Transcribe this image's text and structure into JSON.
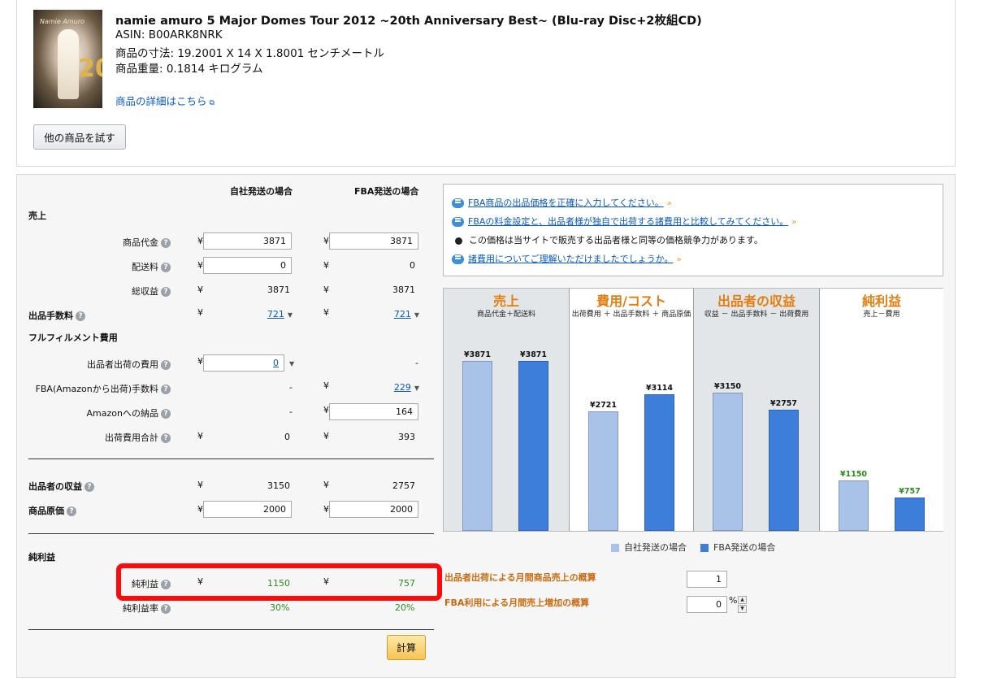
{
  "product": {
    "title": "namie amuro 5 Major Domes Tour 2012 ~20th Anniversary Best~ (Blu-ray Disc+2枚組CD)",
    "asin": "ASIN: B00ARK8NRK",
    "dimensions": "商品の寸法: 19.2001 X 14 X 1.8001 センチメートル",
    "weight": "商品重量: 0.1814 キログラム",
    "detail_link": "商品の詳細はこちら",
    "try_other_button": "他の商品を試す",
    "cover_logo": "Namie Amuro",
    "cover_number": "20"
  },
  "calculator": {
    "col_headers": {
      "merchant": "自社発送の場合",
      "fba": "FBA発送の場合"
    },
    "currency": "¥",
    "sections": {
      "sales": "売上",
      "fulfillment": "フルフィルメント費用",
      "net_profit": "純利益"
    },
    "rows": {
      "item_price": {
        "label": "商品代金",
        "merchant": "3871",
        "fba": "3871"
      },
      "shipping": {
        "label": "配送料",
        "merchant": "0",
        "fba": "0"
      },
      "total_revenue": {
        "label": "総収益",
        "merchant": "3871",
        "fba": "3871"
      },
      "selling_fee": {
        "label": "出品手数料",
        "merchant": "721",
        "fba": "721"
      },
      "merchant_shipping_cost": {
        "label": "出品者出荷の費用",
        "merchant": "0",
        "fba": "-"
      },
      "fba_fee": {
        "label": "FBA(Amazonから出荷)手数料",
        "merchant": "-",
        "fba": "229"
      },
      "inbound": {
        "label": "Amazonへの納品",
        "merchant": "-",
        "fba": "164"
      },
      "total_shipping": {
        "label": "出荷費用合計",
        "merchant": "0",
        "fba": "393"
      },
      "seller_proceeds": {
        "label": "出品者の収益",
        "merchant": "3150",
        "fba": "2757"
      },
      "cost_of_goods": {
        "label": "商品原価",
        "merchant": "2000",
        "fba": "2000"
      },
      "net_profit": {
        "label": "純利益",
        "merchant": "1150",
        "fba": "757"
      },
      "net_margin": {
        "label": "純利益率",
        "merchant": "30%",
        "fba": "20%"
      }
    },
    "calc_button": "計算",
    "help_glyph": "?"
  },
  "info": {
    "line1": "FBA商品の出品価格を正確に入力してください。",
    "line2": "FBAの料金設定と、出品者様が独自で出荷する諸費用と比較してみてください。",
    "line3": "この価格は当サイトで販売する出品者様と同等の価格競争力があります。",
    "line4": "諸費用についてご理解いただけましたでしょうか。"
  },
  "chart_data": {
    "type": "bar",
    "categories": [
      "売上",
      "費用/コスト",
      "出品者の収益",
      "純利益"
    ],
    "subtitles": [
      "商品代金＋配送料",
      "出荷費用 ＋ 出品手数料 ＋ 商品原価",
      "収益 － 出品手数料 － 出荷費用",
      "売上－費用"
    ],
    "series": [
      {
        "name": "自社発送の場合",
        "values": [
          3871,
          2721,
          3150,
          1150
        ]
      },
      {
        "name": "FBA発送の場合",
        "values": [
          3871,
          3114,
          2757,
          757
        ]
      }
    ],
    "value_labels": {
      "merchant": [
        "¥3871",
        "¥2721",
        "¥3150",
        "¥1150"
      ],
      "fba": [
        "¥3871",
        "¥3114",
        "¥2757",
        "¥757"
      ]
    },
    "ylim": [
      0,
      4400
    ],
    "colors": {
      "merchant": "#a9c2e8",
      "fba": "#3d7edb",
      "title": "#e37d10",
      "profit_label": "#2c8a1d"
    }
  },
  "estimates": {
    "monthly_merchant_label": "出品者出荷による月間商品売上の概算",
    "monthly_merchant_value": "1",
    "fba_increase_label": "FBA利用による月間売上増加の概算",
    "fba_increase_value": "0",
    "percent_sign": "%"
  }
}
